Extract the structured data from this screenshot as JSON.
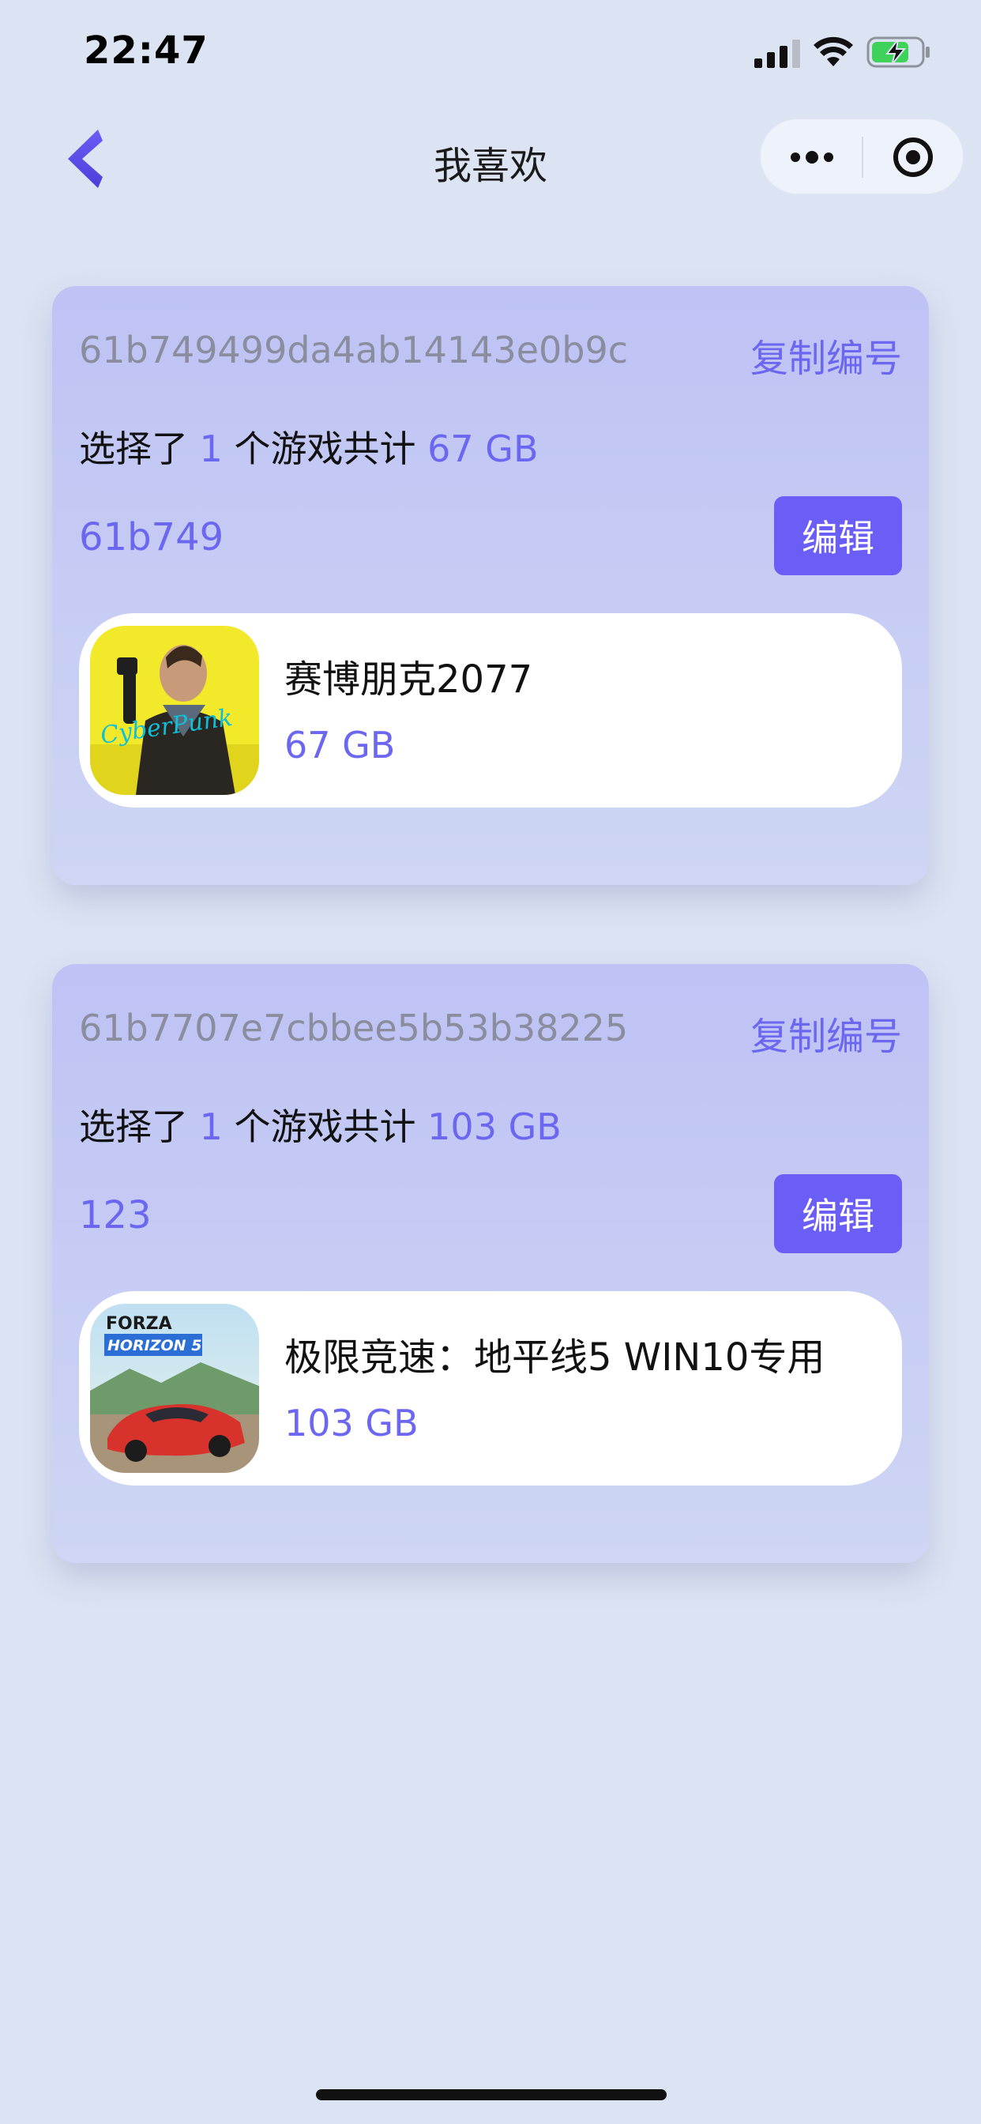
{
  "status_bar": {
    "time": "22:47"
  },
  "nav": {
    "title": "我喜欢"
  },
  "cards": [
    {
      "id": "61b749499da4ab14143e0b9c",
      "copy_label": "复制编号",
      "summary_prefix": "选择了",
      "count": "1",
      "summary_middle": "个游戏共计",
      "total": "67 GB",
      "name": "61b749",
      "edit_label": "编辑",
      "game": {
        "title": "赛博朋克2077",
        "size": "67 GB"
      }
    },
    {
      "id": "61b7707e7cbbee5b53b38225",
      "copy_label": "复制编号",
      "summary_prefix": "选择了",
      "count": "1",
      "summary_middle": "个游戏共计",
      "total": "103 GB",
      "name": "123",
      "edit_label": "编辑",
      "game": {
        "title": "极限竞速：地平线5 WIN10专用",
        "size": "103 GB"
      }
    }
  ]
}
